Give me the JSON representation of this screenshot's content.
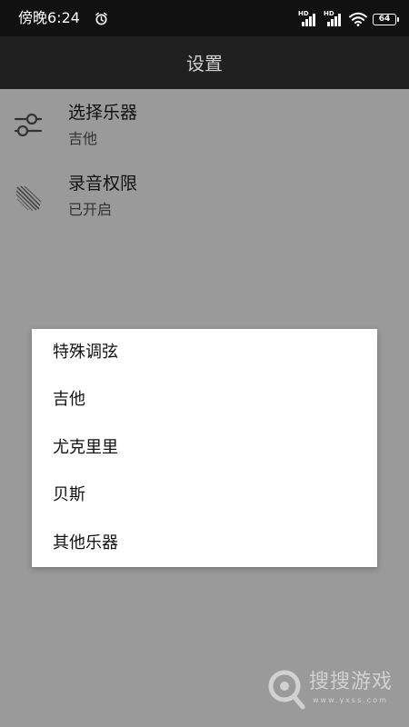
{
  "status_bar": {
    "time": "傍晚6:24",
    "battery": "64",
    "signal_label": "HD"
  },
  "app_bar": {
    "title": "设置"
  },
  "settings": [
    {
      "title": "选择乐器",
      "value": "吉他",
      "icon": "sliders-icon"
    },
    {
      "title": "录音权限",
      "value": "已开启",
      "icon": "microphone-stripes-icon"
    }
  ],
  "dialog": {
    "options": [
      "特殊调弦",
      "吉他",
      "尤克里里",
      "贝斯",
      "其他乐器"
    ]
  },
  "watermark": {
    "text": "搜搜游戏",
    "url": "www.yxss.com"
  },
  "colors": {
    "overlay": "#9a9a9a",
    "status_bar": "#111111",
    "app_bar": "#202020",
    "dialog": "#ffffff"
  }
}
